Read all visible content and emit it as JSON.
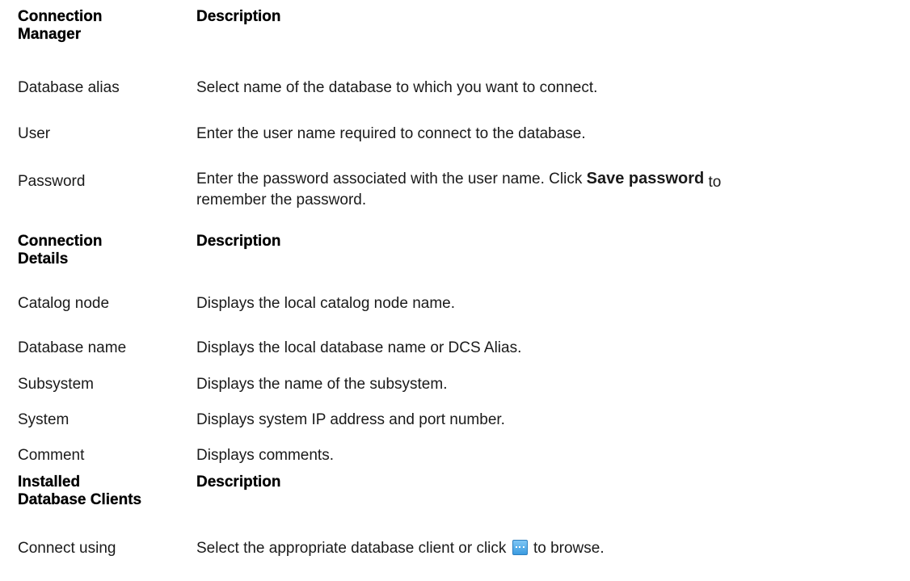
{
  "sections": [
    {
      "header": {
        "col1_line1": "Connection",
        "col1_line2": "Manager",
        "col2": "Description"
      },
      "rows": [
        {
          "name": "Database alias",
          "desc": "Select name of the database to which you want to connect."
        },
        {
          "name": "User",
          "desc": "Enter the user name required to connect to the database."
        },
        {
          "name": "Password",
          "desc_before": "Enter the password associated with the user name. Click ",
          "desc_strong": "Save password",
          "desc_after": " to",
          "desc_line2": "remember the password."
        }
      ]
    },
    {
      "header": {
        "col1_line1": "Connection",
        "col1_line2": "Details",
        "col2": "Description"
      },
      "rows": [
        {
          "name": "Catalog node",
          "desc": "Displays the local catalog node name."
        },
        {
          "name": "Database name",
          "desc": "Displays the local database name or DCS Alias."
        },
        {
          "name": "Subsystem",
          "desc": "Displays the name of the subsystem."
        },
        {
          "name": "System",
          "desc": "Displays system IP address and port number."
        },
        {
          "name": "Comment",
          "desc": "Displays comments."
        }
      ]
    },
    {
      "header": {
        "col1_line1": "Installed",
        "col1_line2": "Database Clients",
        "col2": "Description"
      },
      "rows": [
        {
          "name": "Connect using",
          "desc_before": "Select the appropriate database client or click ",
          "icon": "browse-ellipsis-icon",
          "desc_after": " to browse."
        }
      ]
    }
  ]
}
